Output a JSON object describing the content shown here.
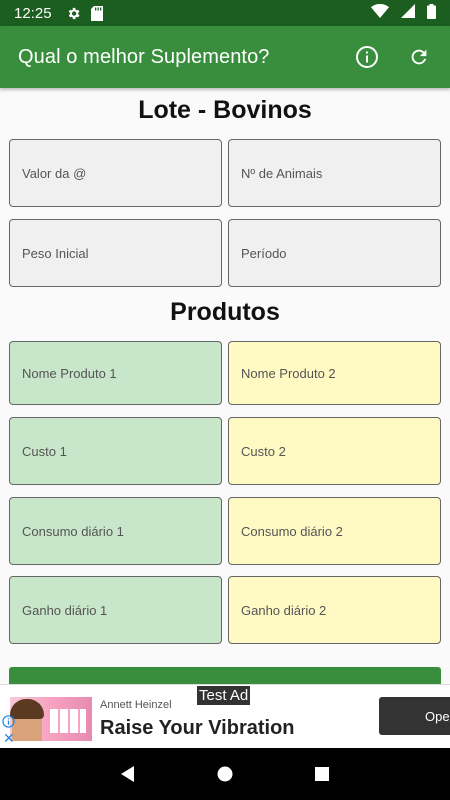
{
  "status_bar": {
    "time": "12:25",
    "icons": [
      "gear-icon",
      "sd-card-icon",
      "wifi-icon",
      "signal-icon",
      "battery-icon"
    ]
  },
  "app_bar": {
    "title": "Qual o melhor Suplemento?",
    "actions": [
      "info-icon",
      "refresh-icon"
    ],
    "color": "#388e3c"
  },
  "lote": {
    "title": "Lote - Bovinos",
    "fields": {
      "valor": {
        "placeholder": "Valor da @",
        "value": ""
      },
      "animais": {
        "placeholder": "Nº de Animais",
        "value": ""
      },
      "peso": {
        "placeholder": "Peso Inicial",
        "value": ""
      },
      "periodo": {
        "placeholder": "Período",
        "value": ""
      }
    }
  },
  "produtos": {
    "title": "Produtos",
    "produto1": {
      "color": "#c8e6c9",
      "nome": "Nome Produto 1",
      "custo": "Custo 1",
      "consumo": "Consumo diário 1",
      "ganho": "Ganho diário 1"
    },
    "produto2": {
      "color": "#fff9c4",
      "nome": "Nome Produto 2",
      "custo": "Custo 2",
      "consumo": "Consumo diário 2",
      "ganho": "Ganho diário 2"
    }
  },
  "ad": {
    "badge": "Test Ad",
    "advertiser": "Annett Heinzel",
    "headline": "Raise Your Vibration",
    "cta": "Open"
  },
  "nav": [
    "back-icon",
    "home-icon",
    "recents-icon"
  ]
}
